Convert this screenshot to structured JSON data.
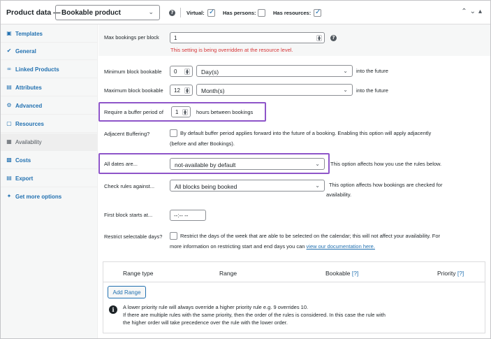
{
  "header": {
    "title": "Product data —",
    "product_type": "Bookable product",
    "virtual_label": "Virtual:",
    "has_persons_label": "Has persons:",
    "has_resources_label": "Has resources:",
    "virtual_checked": true,
    "has_persons_checked": false,
    "has_resources_checked": true
  },
  "sidebar": {
    "items": [
      {
        "label": "Templates",
        "icon": "templates-icon"
      },
      {
        "label": "General",
        "icon": "wrench-icon"
      },
      {
        "label": "Linked Products",
        "icon": "link-icon"
      },
      {
        "label": "Attributes",
        "icon": "attributes-icon"
      },
      {
        "label": "Advanced",
        "icon": "gear-icon"
      },
      {
        "label": "Resources",
        "icon": "resources-icon"
      },
      {
        "label": "Availability",
        "icon": "calendar-icon",
        "active": true
      },
      {
        "label": "Costs",
        "icon": "costs-icon"
      },
      {
        "label": "Export",
        "icon": "export-icon"
      },
      {
        "label": "Get more options",
        "icon": "plugin-icon"
      }
    ]
  },
  "fields": {
    "max_bookings": {
      "label": "Max bookings per block",
      "value": "1",
      "error": "This setting is being overridden at the resource level."
    },
    "min_bookable": {
      "label": "Minimum block bookable",
      "value": "0",
      "unit": "Day(s)",
      "suffix": "into the future"
    },
    "max_bookable": {
      "label": "Maximum block bookable",
      "value": "12",
      "unit": "Month(s)",
      "suffix": "into the future"
    },
    "buffer": {
      "label": "Require a buffer period of",
      "value": "1",
      "suffix": "hours between bookings"
    },
    "adjacent": {
      "label": "Adjacent Buffering?",
      "line1": "By default buffer period applies forward into the future of a booking. Enabling this option will apply adjacently",
      "line2": "(before and after Bookings)."
    },
    "all_dates": {
      "label": "All dates are...",
      "value": "not-available by default",
      "desc": "This option affects how you use the rules below."
    },
    "check_rules": {
      "label": "Check rules against...",
      "value": "All blocks being booked",
      "desc1": "This option affects how bookings are checked for",
      "desc2": "availability."
    },
    "first_block": {
      "label": "First block starts at...",
      "value": "--:-- --"
    },
    "restrict_days": {
      "label": "Restrict selectable days?",
      "line1": "Restrict the days of the week that are able to be selected on the calendar; this will not affect your availability. For",
      "line2_pre": "more information on restricting start and end days you can",
      "link": "view our documentation here."
    }
  },
  "ranges": {
    "columns": [
      "Range type",
      "Range",
      "Bookable",
      "Priority"
    ],
    "help_marker": "[?]",
    "add_button": "Add Range",
    "info_line1": "A lower priority rule will always override a higher priority rule e.g. 9 overrides 10.",
    "info_line2": "If there are multiple rules with the same priority, then the order of the rules is considered. In this case the rule with",
    "info_line3": "the higher order will take precedence over the rule with the lower order."
  },
  "colors": {
    "accent": "#2271b1",
    "highlight": "#8e55c9",
    "error": "#d63638"
  }
}
